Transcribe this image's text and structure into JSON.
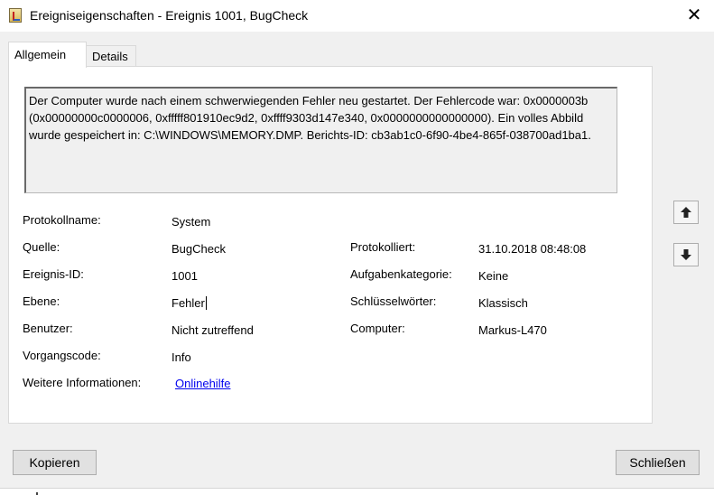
{
  "window": {
    "title": "Ereigniseigenschaften - Ereignis 1001, BugCheck",
    "close_symbol": "✕",
    "icon": "event-viewer-icon"
  },
  "tabs": [
    {
      "label": "Allgemein",
      "active": true
    },
    {
      "label": "Details",
      "active": false
    }
  ],
  "description": "Der Computer wurde nach einem schwerwiegenden Fehler neu gestartet. Der Fehlercode war: 0x0000003b (0x00000000c0000006, 0xfffff801910ec9d2, 0xffff9303d147e340, 0x0000000000000000). Ein volles Abbild wurde gespeichert in: C:\\WINDOWS\\MEMORY.DMP. Berichts-ID: cb3ab1c0-6f90-4be4-865f-038700ad1ba1.",
  "fields": {
    "protokollname": {
      "label": "Protokollname:",
      "value": "System"
    },
    "quelle": {
      "label": "Quelle:",
      "value": "BugCheck"
    },
    "ereignis_id": {
      "label": "Ereignis-ID:",
      "value": "1001"
    },
    "ebene": {
      "label": "Ebene:",
      "value": "Fehler"
    },
    "benutzer": {
      "label": "Benutzer:",
      "value": "Nicht zutreffend"
    },
    "vorgangscode": {
      "label": "Vorgangscode:",
      "value": "Info"
    },
    "weitere_informationen": {
      "label": "Weitere Informationen:",
      "value": "Onlinehilfe"
    },
    "protokolliert": {
      "label": "Protokolliert:",
      "value": "31.10.2018 08:48:08"
    },
    "aufgabenkategorie": {
      "label": "Aufgabenkategorie:",
      "value": "Keine"
    },
    "schluesselwoerter": {
      "label": "Schlüsselwörter:",
      "value": "Klassisch"
    },
    "computer": {
      "label": "Computer:",
      "value": "Markus-L470"
    }
  },
  "nav": {
    "up_icon": "arrow-up-icon",
    "down_icon": "arrow-down-icon"
  },
  "buttons": {
    "copy": "Kopieren",
    "close": "Schließen"
  }
}
